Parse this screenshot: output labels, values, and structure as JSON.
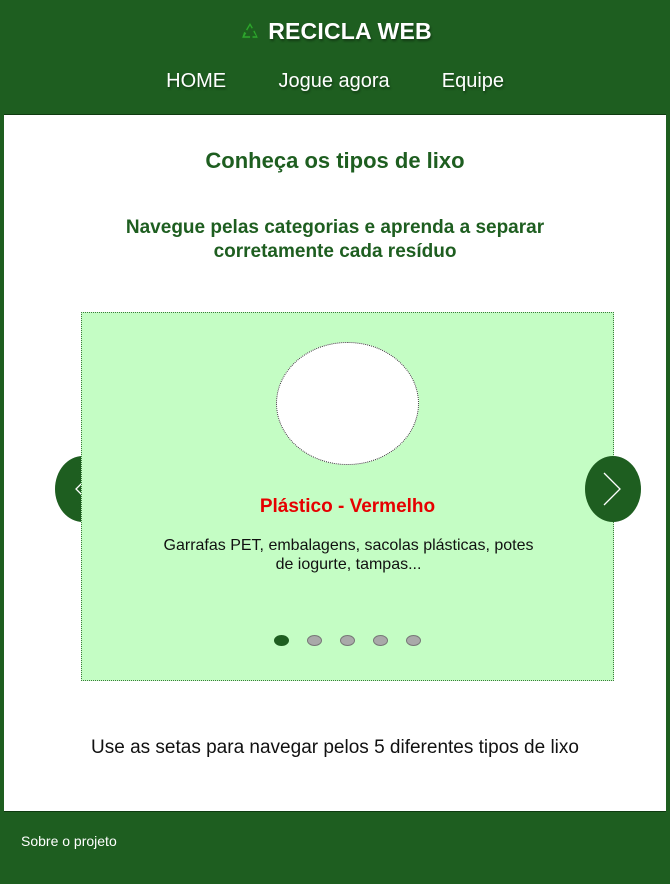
{
  "header": {
    "brand_title": "RECICLA WEB",
    "brand_icon": "recycle-icon",
    "nav": [
      {
        "label": "HOME"
      },
      {
        "label": "Jogue agora"
      },
      {
        "label": "Equipe"
      }
    ]
  },
  "main": {
    "title": "Conheça os tipos de lixo",
    "subtitle": "Navegue pelas categorias e aprenda a separar corretamente cada resíduo",
    "carousel": {
      "title": "Plástico - Vermelho",
      "description": "Garrafas PET, embalagens, sacolas plásticas, potes de iogurte, tampas...",
      "slide_count": 5,
      "active_slide": 1,
      "prev_icon": "chevron-left-icon",
      "next_icon": "chevron-right-icon"
    },
    "hint": "Use as setas para navegar pelos 5 diferentes tipos de lixo"
  },
  "footer": {
    "link_label": "Sobre o projeto"
  },
  "colors": {
    "primary_green": "#1e5e20",
    "card_background": "#c4fdc4",
    "category_red": "#e60000"
  }
}
